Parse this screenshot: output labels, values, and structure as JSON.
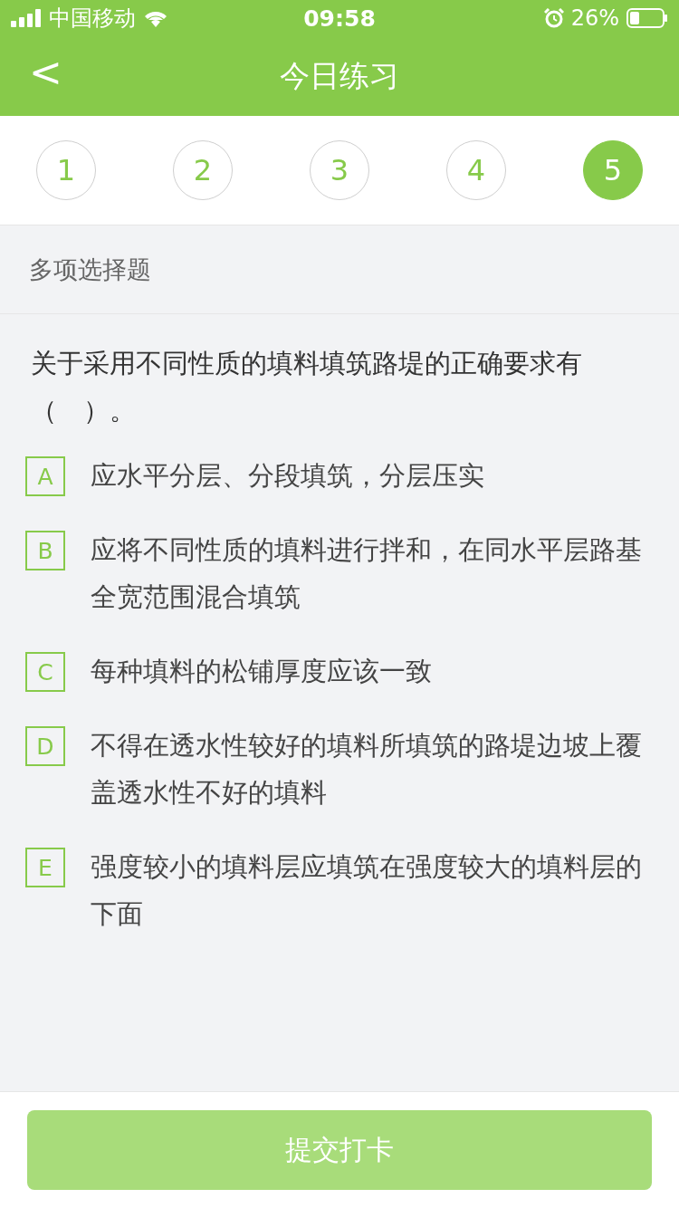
{
  "status_bar": {
    "carrier": "中国移动",
    "time": "09:58",
    "battery": "26%"
  },
  "header": {
    "back": "<",
    "title": "今日练习"
  },
  "steps": [
    {
      "label": "1",
      "selected": false
    },
    {
      "label": "2",
      "selected": false
    },
    {
      "label": "3",
      "selected": false
    },
    {
      "label": "4",
      "selected": false
    },
    {
      "label": "5",
      "selected": true
    }
  ],
  "question_type": "多项选择题",
  "question": "关于采用不同性质的填料填筑路堤的正确要求有（　）。",
  "options": [
    {
      "letter": "A",
      "text": "应水平分层、分段填筑，分层压实",
      "checked": false
    },
    {
      "letter": "B",
      "text": "应将不同性质的填料进行拌和，在同水平层路基全宽范围混合填筑",
      "checked": false
    },
    {
      "letter": "C",
      "text": "每种填料的松铺厚度应该一致",
      "checked": false
    },
    {
      "letter": "D",
      "text": "不得在透水性较好的填料所填筑的路堤边坡上覆盖透水性不好的填料",
      "checked": false
    },
    {
      "letter": "E",
      "text": "强度较小的填料层应填筑在强度较大的填料层的下面",
      "checked": false
    }
  ],
  "submit_button": {
    "label": "提交打卡",
    "disabled": true
  }
}
